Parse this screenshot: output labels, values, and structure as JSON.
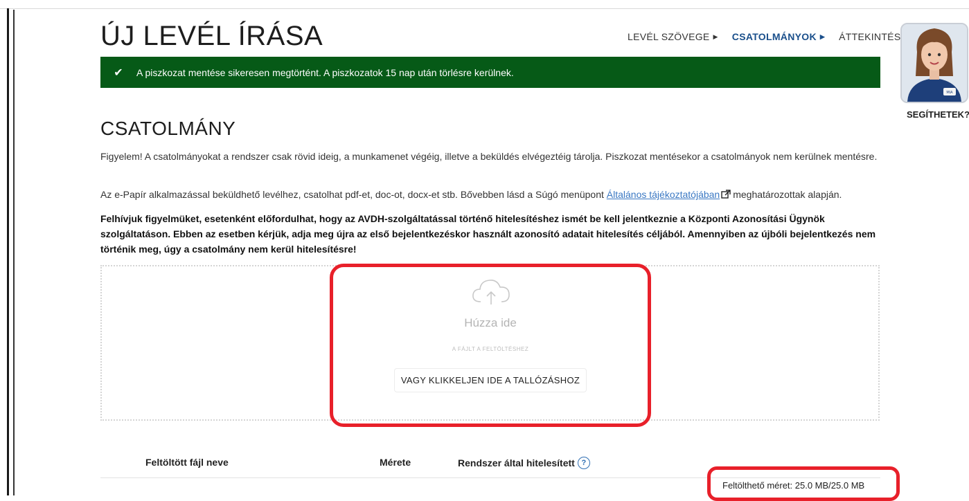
{
  "page": {
    "title": "ÚJ LEVÉL ÍRÁSA"
  },
  "steps": [
    {
      "label": "LEVÉL SZÖVEGE",
      "active": false
    },
    {
      "label": "CSATOLMÁNYOK",
      "active": true
    },
    {
      "label": "ÁTTEKINTÉS",
      "active": false
    }
  ],
  "alert": {
    "text": "A piszkozat mentése sikeresen megtörtént. A piszkozatok 15 nap után törlésre kerülnek.",
    "color": "#065a17"
  },
  "assistant": {
    "label": "SEGÍTHETEK?",
    "badge": "MIA"
  },
  "section": {
    "title": "CSATOLMÁNY",
    "para1": "Figyelem! A csatolmányokat a rendszer csak rövid ideig, a munkamenet végéig, illetve a beküldés elvégeztéig tárolja. Piszkozat mentésekor a csatolmányok nem kerülnek mentésre.",
    "para2_before": "Az e-Papír alkalmazással beküldhető levélhez, csatolhat pdf-et, doc-ot, docx-et stb. Bővebben lásd a Súgó menüpont ",
    "para2_link": "Általános tájékoztatójában",
    "para2_after": "meghatározottak alapján.",
    "para3": "Felhívjuk figyelmüket, esetenként előfordulhat, hogy az AVDH-szolgáltatással történő hitelesítéshez ismét be kell jelentkeznie a Központi Azonosítási Ügynök szolgáltatáson. Ebben az esetben kérjük, adja meg újra az első bejelentkezéskor használt azonosító adatait hitelesítés céljából. Amennyiben az újbóli bejelentkezés nem történik meg, úgy a csatolmány nem kerül hitelesítésre!"
  },
  "dropzone": {
    "drag_text": "Húzza ide",
    "sub_text": "A FÁJLT A FELTÖLTÉSHEZ",
    "browse_label": "VAGY KLIKKELJEN IDE A TALLÓZÁSHOZ"
  },
  "table": {
    "columns": [
      "Feltöltött fájl neve",
      "Mérete",
      "Rendszer által hitelesített"
    ]
  },
  "upload_status": "Feltölthető méret: 25.0 MB/25.0 MB",
  "colors": {
    "accent": "#1a4f8b",
    "highlight": "#e8202a",
    "link": "#3a78c3"
  }
}
